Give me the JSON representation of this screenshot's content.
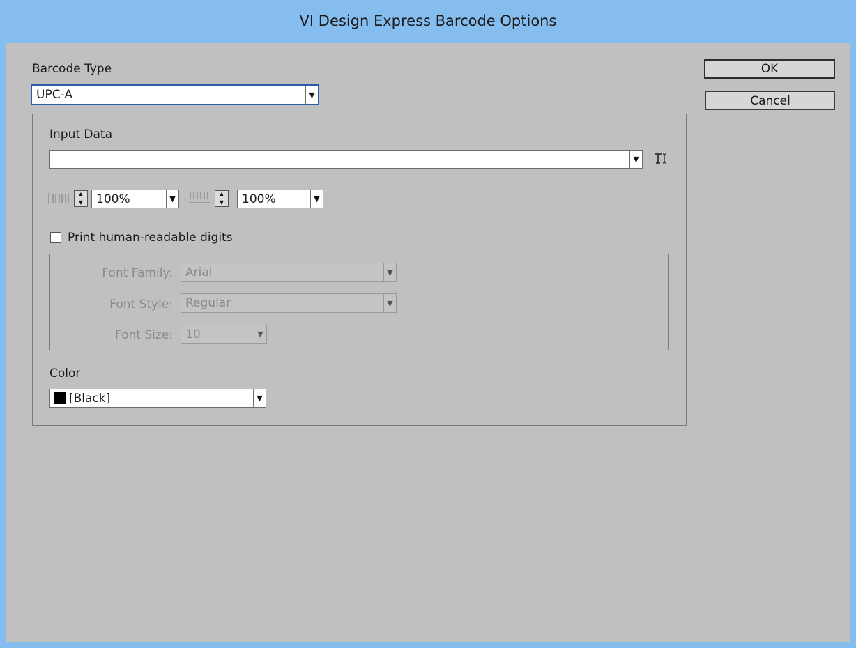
{
  "window": {
    "title": "VI Design Express Barcode Options"
  },
  "barcode_type": {
    "label": "Barcode Type",
    "value": "UPC-A"
  },
  "buttons": {
    "ok": "OK",
    "cancel": "Cancel"
  },
  "input_data": {
    "label": "Input Data",
    "value": ""
  },
  "scale": {
    "width_value": "100%",
    "height_value": "100%"
  },
  "human_readable": {
    "checkbox_label": "Print human-readable digits",
    "checked": false,
    "font_family_label": "Font Family:",
    "font_family_value": "Arial",
    "font_style_label": "Font Style:",
    "font_style_value": "Regular",
    "font_size_label": "Font Size:",
    "font_size_value": "10"
  },
  "color": {
    "label": "Color",
    "value": "[Black]",
    "swatch": "#000000"
  },
  "icons": {
    "dropdown_arrow": "▼",
    "spin_up": "▲",
    "spin_down": "▼",
    "text_insert_icon": "T-insert",
    "bar_width_icon": "bar-width",
    "bar_height_icon": "bar-height"
  },
  "colors": {
    "titlebar": "#85bdee",
    "dialog_bg": "#c0c0c0",
    "focus_border": "#2b5aa8"
  }
}
